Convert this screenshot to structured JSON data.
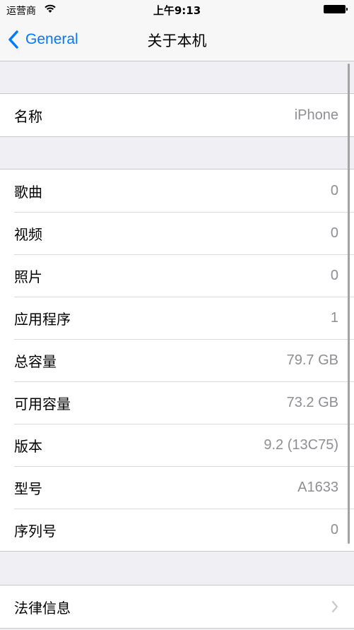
{
  "status_bar": {
    "carrier": "运营商",
    "time": "上午9:13",
    "wifi_icon": "wifi-icon",
    "battery_icon": "battery-full-icon"
  },
  "nav": {
    "back_label": "General",
    "back_icon": "chevron-left-icon",
    "title": "关于本机",
    "accent_color": "#007aff"
  },
  "groups": [
    {
      "rows": [
        {
          "label": "名称",
          "value": "iPhone"
        }
      ]
    },
    {
      "rows": [
        {
          "label": "歌曲",
          "value": "0"
        },
        {
          "label": "视频",
          "value": "0"
        },
        {
          "label": "照片",
          "value": "0"
        },
        {
          "label": "应用程序",
          "value": "1"
        },
        {
          "label": "总容量",
          "value": "79.7 GB"
        },
        {
          "label": "可用容量",
          "value": "73.2 GB"
        },
        {
          "label": "版本",
          "value": "9.2 (13C75)"
        },
        {
          "label": "型号",
          "value": "A1633"
        },
        {
          "label": "序列号",
          "value": "0"
        }
      ]
    },
    {
      "rows": [
        {
          "label": "法律信息",
          "disclosure_icon": "chevron-right-icon"
        }
      ]
    }
  ]
}
